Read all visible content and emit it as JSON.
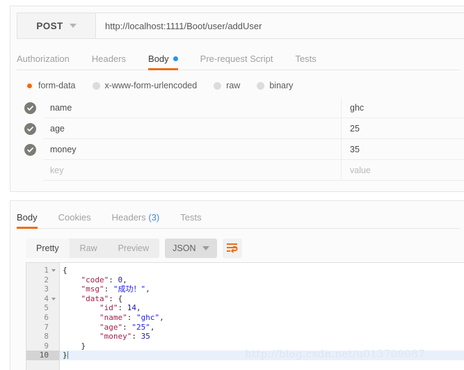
{
  "request": {
    "method": "POST",
    "url": "http://localhost:1111/Boot/user/addUser",
    "tabs": [
      {
        "label": "Authorization",
        "active": false,
        "dot": false
      },
      {
        "label": "Headers",
        "active": false,
        "dot": false
      },
      {
        "label": "Body",
        "active": true,
        "dot": true
      },
      {
        "label": "Pre-request Script",
        "active": false,
        "dot": false
      },
      {
        "label": "Tests",
        "active": false,
        "dot": false
      }
    ],
    "body_types": [
      {
        "label": "form-data",
        "checked": true
      },
      {
        "label": "x-www-form-urlencoded",
        "checked": false
      },
      {
        "label": "raw",
        "checked": false
      },
      {
        "label": "binary",
        "checked": false
      }
    ],
    "form_rows": [
      {
        "enabled": true,
        "key": "name",
        "value": "ghc"
      },
      {
        "enabled": true,
        "key": "age",
        "value": "25"
      },
      {
        "enabled": true,
        "key": "money",
        "value": "35"
      }
    ],
    "key_placeholder": "key",
    "value_placeholder": "value"
  },
  "response": {
    "tabs": [
      {
        "label": "Body",
        "count": "",
        "active": true
      },
      {
        "label": "Cookies",
        "count": "",
        "active": false
      },
      {
        "label": "Headers",
        "count": "(3)",
        "active": false
      },
      {
        "label": "Tests",
        "count": "",
        "active": false
      }
    ],
    "view_modes": [
      {
        "label": "Pretty",
        "active": true
      },
      {
        "label": "Raw",
        "active": false
      },
      {
        "label": "Preview",
        "active": false
      }
    ],
    "language": "JSON",
    "wrap_icon": "word-wrap-icon",
    "line_numbers": [
      "1",
      "2",
      "3",
      "4",
      "5",
      "6",
      "7",
      "8",
      "9",
      "10"
    ],
    "active_line": 10,
    "fold_lines": [
      1,
      4
    ],
    "body_lines": [
      [
        {
          "t": "{",
          "c": "punc"
        }
      ],
      [
        {
          "t": "    ",
          "c": "punc"
        },
        {
          "t": "\"code\"",
          "c": "key"
        },
        {
          "t": ": ",
          "c": "punc"
        },
        {
          "t": "0",
          "c": "num"
        },
        {
          "t": ",",
          "c": "punc"
        }
      ],
      [
        {
          "t": "    ",
          "c": "punc"
        },
        {
          "t": "\"msg\"",
          "c": "key"
        },
        {
          "t": ": ",
          "c": "punc"
        },
        {
          "t": "\"成功！\"",
          "c": "str"
        },
        {
          "t": ",",
          "c": "punc"
        }
      ],
      [
        {
          "t": "    ",
          "c": "punc"
        },
        {
          "t": "\"data\"",
          "c": "key"
        },
        {
          "t": ": ",
          "c": "punc"
        },
        {
          "t": "{",
          "c": "punc"
        }
      ],
      [
        {
          "t": "        ",
          "c": "punc"
        },
        {
          "t": "\"id\"",
          "c": "key"
        },
        {
          "t": ": ",
          "c": "punc"
        },
        {
          "t": "14",
          "c": "num"
        },
        {
          "t": ",",
          "c": "punc"
        }
      ],
      [
        {
          "t": "        ",
          "c": "punc"
        },
        {
          "t": "\"name\"",
          "c": "key"
        },
        {
          "t": ": ",
          "c": "punc"
        },
        {
          "t": "\"ghc\"",
          "c": "str"
        },
        {
          "t": ",",
          "c": "punc"
        }
      ],
      [
        {
          "t": "        ",
          "c": "punc"
        },
        {
          "t": "\"age\"",
          "c": "key"
        },
        {
          "t": ": ",
          "c": "punc"
        },
        {
          "t": "\"25\"",
          "c": "str"
        },
        {
          "t": ",",
          "c": "punc"
        }
      ],
      [
        {
          "t": "        ",
          "c": "punc"
        },
        {
          "t": "\"money\"",
          "c": "key"
        },
        {
          "t": ": ",
          "c": "punc"
        },
        {
          "t": "35",
          "c": "num"
        }
      ],
      [
        {
          "t": "    ",
          "c": "punc"
        },
        {
          "t": "}",
          "c": "punc"
        }
      ],
      [
        {
          "t": "}",
          "c": "punc"
        }
      ]
    ]
  },
  "watermark": "http://blog.csdn.net/u013709087",
  "colors": {
    "accent": "#ef6c13",
    "blue_dot": "#2196f3",
    "header_count": "#3c8cdc",
    "panel_bg": "#fbfbfb",
    "checkbox": "#7d7b76"
  }
}
